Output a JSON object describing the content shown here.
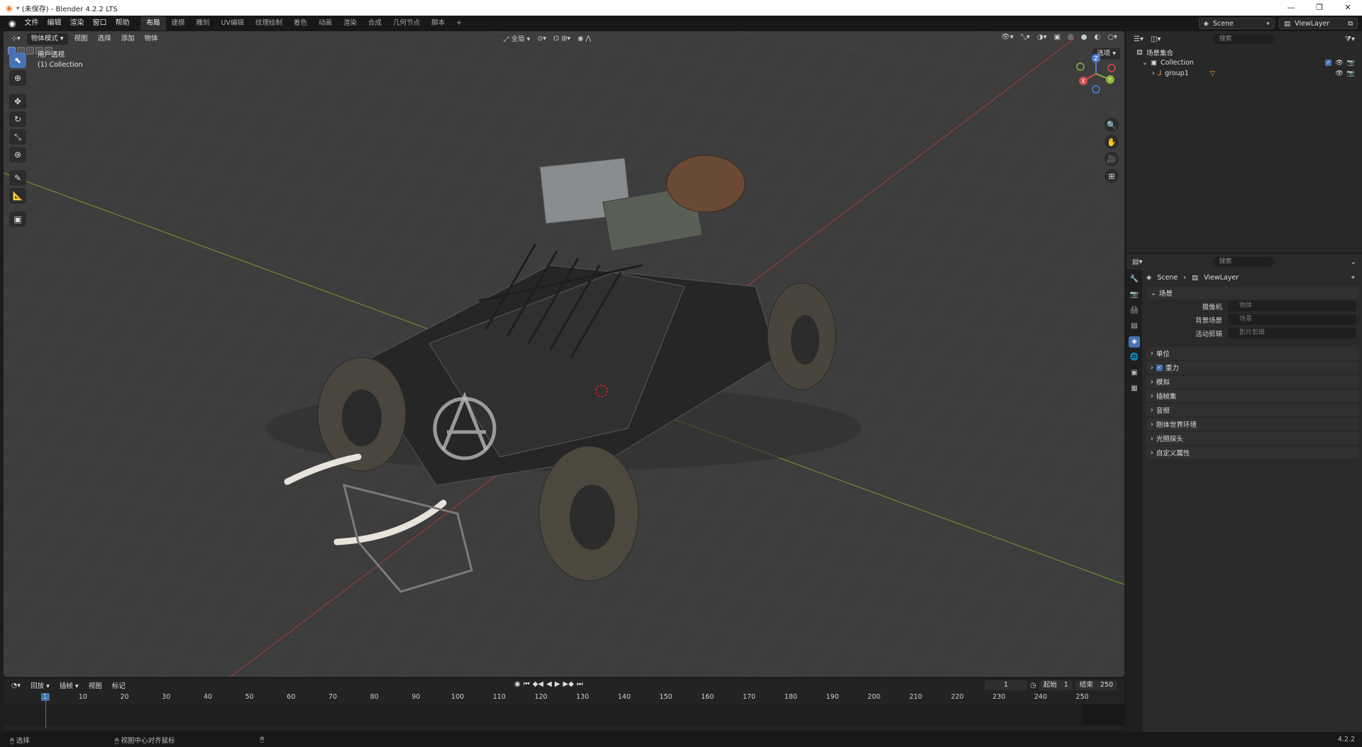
{
  "window": {
    "title": "* (未保存) - Blender 4.2.2 LTS",
    "min": "—",
    "max": "❐",
    "close": "✕"
  },
  "menu": {
    "items": [
      "文件",
      "编辑",
      "渲染",
      "窗口",
      "帮助"
    ]
  },
  "workspaces": [
    "布局",
    "建模",
    "雕刻",
    "UV编辑",
    "纹理绘制",
    "着色",
    "动画",
    "渲染",
    "合成",
    "几何节点",
    "脚本",
    "+"
  ],
  "topright": {
    "scene": "Scene",
    "viewlayer": "ViewLayer"
  },
  "viewport": {
    "mode": "物体模式",
    "menu": [
      "视图",
      "选择",
      "添加",
      "物体"
    ],
    "transform": "全局",
    "options": "选项",
    "info_line1": "用户透视",
    "info_line2": "(1) Collection"
  },
  "timeline": {
    "menu": [
      "回放",
      "插帧",
      "视图",
      "标记"
    ],
    "current_frame": "1",
    "start_label": "起始",
    "start": "1",
    "end_label": "结束",
    "end": "250",
    "ticks": [
      "1",
      "10",
      "20",
      "30",
      "40",
      "50",
      "60",
      "70",
      "80",
      "90",
      "100",
      "110",
      "120",
      "130",
      "140",
      "150",
      "160",
      "170",
      "180",
      "190",
      "200",
      "210",
      "220",
      "230",
      "240",
      "250"
    ]
  },
  "statusbar": {
    "select": "选择",
    "center": "视图中心对齐鼠标",
    "version": "4.2.2"
  },
  "outliner": {
    "search": "搜索",
    "root": "场景集合",
    "collection": "Collection",
    "object": "group1"
  },
  "properties": {
    "search": "搜索",
    "crumb_scene": "Scene",
    "crumb_viewlayer": "ViewLayer",
    "scene_panel": "场景",
    "fields": [
      {
        "label": "摄像机",
        "placeholder": "物体"
      },
      {
        "label": "背景场景",
        "placeholder": "场景"
      },
      {
        "label": "活动剪辑",
        "placeholder": "影片剪辑"
      }
    ],
    "panels": [
      "单位",
      "重力",
      "模拟",
      "插帧集",
      "音频",
      "刚体世界环境",
      "光照探头",
      "自定义属性"
    ]
  }
}
